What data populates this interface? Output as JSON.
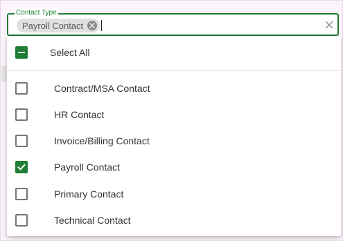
{
  "field": {
    "label": "Contact Type",
    "selected_chip": "Payroll Contact"
  },
  "dropdown": {
    "select_all_label": "Select All",
    "select_all_state": "indeterminate",
    "options": [
      {
        "label": "Contract/MSA Contact",
        "checked": false
      },
      {
        "label": "HR Contact",
        "checked": false
      },
      {
        "label": "Invoice/Billing Contact",
        "checked": false
      },
      {
        "label": "Payroll Contact",
        "checked": true
      },
      {
        "label": "Primary Contact",
        "checked": false
      },
      {
        "label": "Technical Contact",
        "checked": false
      }
    ]
  },
  "colors": {
    "accent": "#1e7e34",
    "chip_bg": "#e0e0e0",
    "checkbox_border": "#757575"
  },
  "icons": {
    "chip_remove": "close-circle-icon",
    "clear": "close-icon",
    "checked": "check-icon",
    "indeterminate": "minus-icon"
  }
}
